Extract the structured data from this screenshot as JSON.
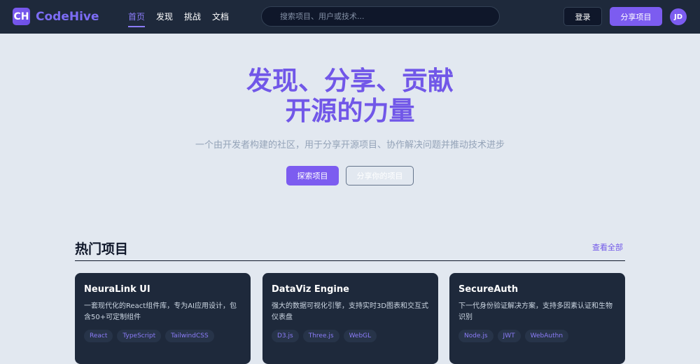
{
  "brand": {
    "badge": "CH",
    "name": "CodeHive",
    "accent": "#7c5cf0"
  },
  "nav": {
    "links": [
      {
        "label": "首页",
        "active": true
      },
      {
        "label": "发现",
        "active": false
      },
      {
        "label": "挑战",
        "active": false
      },
      {
        "label": "文档",
        "active": false
      }
    ],
    "search_placeholder": "搜索项目、用户或技术...",
    "login_label": "登录",
    "share_label": "分享项目",
    "avatar_initials": "JD"
  },
  "hero": {
    "title_line1": "发现、分享、贡献",
    "title_line2": "开源的力量",
    "subtitle": "一个由开发者构建的社区，用于分享开源项目、协作解决问题并推动技术进步",
    "explore_label": "探索项目",
    "share_mine_label": "分享你的项目"
  },
  "trending": {
    "title": "热门项目",
    "view_all_label": "查看全部",
    "cards": [
      {
        "title": "NeuraLink UI",
        "desc": "一套现代化的React组件库，专为AI应用设计，包含50+可定制组件",
        "tags": [
          "React",
          "TypeScript",
          "TailwindCSS"
        ]
      },
      {
        "title": "DataViz Engine",
        "desc": "强大的数据可视化引擎，支持实时3D图表和交互式仪表盘",
        "tags": [
          "D3.js",
          "Three.js",
          "WebGL"
        ]
      },
      {
        "title": "SecureAuth",
        "desc": "下一代身份验证解决方案，支持多因素认证和生物识别",
        "tags": [
          "Node.js",
          "JWT",
          "WebAuthn"
        ]
      }
    ]
  }
}
